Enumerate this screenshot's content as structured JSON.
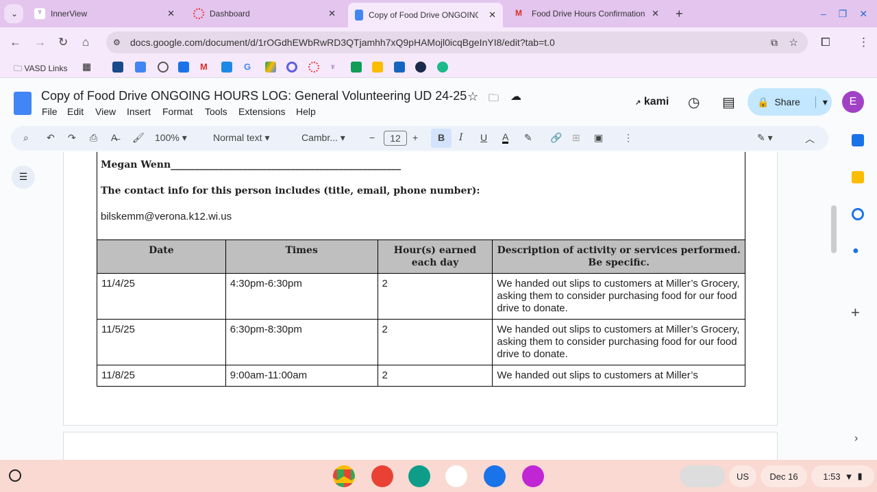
{
  "browser": {
    "tabs": [
      {
        "label": "InnerView"
      },
      {
        "label": "Dashboard"
      },
      {
        "label": "Copy of Food Drive ONGOING H"
      },
      {
        "label": "Food Drive Hours Confirmation"
      }
    ],
    "url": "docs.google.com/document/d/1rOGdhEWbRwRD3QTjamhh7xQ9pHAMojl0icqBgeInYI8/edit?tab=t.0",
    "bookmarks_folder": "VASD Links"
  },
  "doc": {
    "title": "Copy of Food Drive ONGOING HOURS LOG: General Volunteering UD 24-25",
    "menus": [
      "File",
      "Edit",
      "View",
      "Insert",
      "Format",
      "Tools",
      "Extensions",
      "Help"
    ],
    "kami": "kami",
    "share": "Share",
    "avatar": "E",
    "toolbar": {
      "zoom": "100%",
      "style": "Normal text",
      "font": "Cambr...",
      "size": "12"
    }
  },
  "content": {
    "supervisor": "Megan Wenn________________________________________________",
    "contact_label": "The contact info for this person includes (title, email, phone number):",
    "contact": "bilskemm@verona.k12.wi.us",
    "table": {
      "headers": [
        "Date",
        "Times",
        "Hour(s) earned each day",
        "Description of activity or services performed. Be specific."
      ],
      "rows": [
        [
          "11/4/25",
          "4:30pm-6:30pm",
          "2",
          "We handed out slips to customers at Miller’s Grocery, asking them to consider purchasing food for our food drive to donate."
        ],
        [
          "11/5/25",
          "6:30pm-8:30pm",
          "2",
          "We handed out slips to customers at Miller’s Grocery, asking them to consider purchasing food for our food drive to donate."
        ],
        [
          "11/8/25",
          "9:00am-11:00am",
          "2",
          "We handed out slips to customers at Miller’s"
        ]
      ]
    }
  },
  "taskbar": {
    "lang": "US",
    "date": "Dec 16",
    "time": "1:53"
  }
}
